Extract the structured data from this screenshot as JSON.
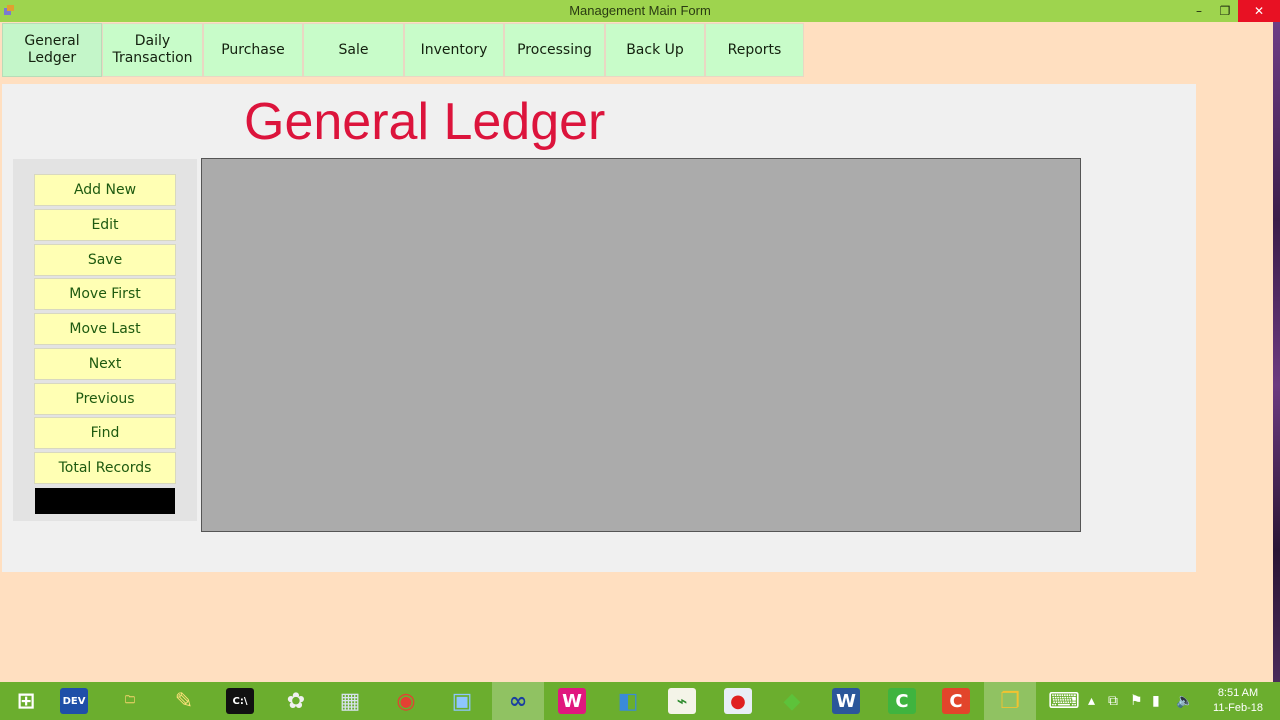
{
  "window": {
    "title": "Management Main Form",
    "min": "–",
    "max": "❐",
    "close": "✕"
  },
  "menu": [
    {
      "label": "General Ledger",
      "lines": [
        "General",
        "Ledger"
      ],
      "name": "menu-general-ledger",
      "width": 100,
      "active": true
    },
    {
      "label": "Daily Transaction",
      "lines": [
        "Daily",
        "Transaction"
      ],
      "name": "menu-daily-transaction",
      "width": 101
    },
    {
      "label": "Purchase",
      "lines": [
        "Purchase"
      ],
      "name": "menu-purchase",
      "width": 100
    },
    {
      "label": "Sale",
      "lines": [
        "Sale"
      ],
      "name": "menu-sale",
      "width": 101
    },
    {
      "label": "Inventory",
      "lines": [
        "Inventory"
      ],
      "name": "menu-inventory",
      "width": 100
    },
    {
      "label": "Processing",
      "lines": [
        "Processing"
      ],
      "name": "menu-processing",
      "width": 101
    },
    {
      "label": "Back Up",
      "lines": [
        "Back Up"
      ],
      "name": "menu-back-up",
      "width": 100
    },
    {
      "label": "Reports",
      "lines": [
        "Reports"
      ],
      "name": "menu-reports",
      "width": 99
    }
  ],
  "page": {
    "title": "General Ledger"
  },
  "actions": [
    {
      "label": "Add New",
      "name": "add-new-button"
    },
    {
      "label": "Edit",
      "name": "edit-button"
    },
    {
      "label": "Save",
      "name": "save-button"
    },
    {
      "label": "Move First",
      "name": "move-first-button"
    },
    {
      "label": "Move Last",
      "name": "move-last-button"
    },
    {
      "label": "Next",
      "name": "next-button"
    },
    {
      "label": "Previous",
      "name": "previous-button"
    },
    {
      "label": "Find",
      "name": "find-button"
    },
    {
      "label": "Total Records",
      "name": "total-records-button"
    }
  ],
  "taskbar": {
    "items": [
      {
        "name": "start-icon",
        "glyph": "⊞",
        "color": "#ffffff",
        "bg": ""
      },
      {
        "name": "dev-icon",
        "glyph": "DEV",
        "color": "#ffffff",
        "bg": "#1f4fa8"
      },
      {
        "name": "file-explorer-icon",
        "glyph": "🗀",
        "color": "#f3d36b",
        "bg": ""
      },
      {
        "name": "tools-icon",
        "glyph": "✎",
        "color": "#ffe27a",
        "bg": ""
      },
      {
        "name": "cmd-icon",
        "glyph": "C:\\",
        "color": "#ffffff",
        "bg": "#111111"
      },
      {
        "name": "paint-icon",
        "glyph": "✿",
        "color": "#f0f0f0",
        "bg": ""
      },
      {
        "name": "calculator-icon",
        "glyph": "▦",
        "color": "#d8e3ee",
        "bg": ""
      },
      {
        "name": "chrome-icon",
        "glyph": "◉",
        "color": "#e34133",
        "bg": ""
      },
      {
        "name": "control-panel-icon",
        "glyph": "▣",
        "color": "#8ec6ff",
        "bg": ""
      },
      {
        "name": "link-app-icon",
        "glyph": "∞",
        "color": "#1a3fa0",
        "bg": "",
        "active": true
      },
      {
        "name": "wamp-icon",
        "glyph": "W",
        "color": "#ffffff",
        "bg": "#e0187e"
      },
      {
        "name": "package-icon",
        "glyph": "◧",
        "color": "#3a8ad8",
        "bg": ""
      },
      {
        "name": "chart-app-icon",
        "glyph": "⌁",
        "color": "#2b8a2b",
        "bg": "#f4f4e8"
      },
      {
        "name": "recorder-icon",
        "glyph": "●",
        "color": "#e02020",
        "bg": "#e8eef6"
      },
      {
        "name": "bluestacks-icon",
        "glyph": "◆",
        "color": "#5dc23a",
        "bg": ""
      },
      {
        "name": "word-icon",
        "glyph": "W",
        "color": "#ffffff",
        "bg": "#2b579a"
      },
      {
        "name": "camtasia-icon",
        "glyph": "C",
        "color": "#ffffff",
        "bg": "#3fb43f"
      },
      {
        "name": "camtasia-recorder-icon",
        "glyph": "C",
        "color": "#ffffff",
        "bg": "#e2452b"
      },
      {
        "name": "running-app-icon",
        "glyph": "❐",
        "color": "#f2c230",
        "bg": "",
        "active": true
      }
    ],
    "tray": [
      {
        "name": "keyboard-icon",
        "glyph": "⌨"
      },
      {
        "name": "show-hidden-icon",
        "glyph": "▴"
      },
      {
        "name": "network-adapter-icon",
        "glyph": "⧉"
      },
      {
        "name": "flag-icon",
        "glyph": "⚑"
      },
      {
        "name": "signal-icon",
        "glyph": "▮"
      },
      {
        "name": "volume-icon",
        "glyph": "🔈"
      }
    ],
    "time": "8:51 AM",
    "date": "11-Feb-18"
  }
}
